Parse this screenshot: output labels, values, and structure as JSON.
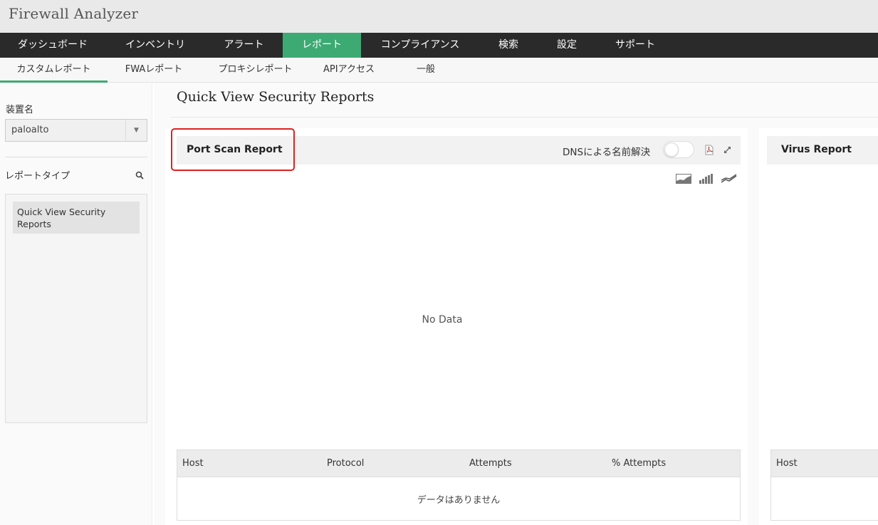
{
  "app": {
    "title": "Firewall Analyzer"
  },
  "colors": {
    "accent": "#3daa73",
    "nav_bg": "#2a2a2a",
    "highlight": "#e02020"
  },
  "mainnav": [
    {
      "label": "ダッシュボード"
    },
    {
      "label": "インベントリ"
    },
    {
      "label": "アラート"
    },
    {
      "label": "レポート",
      "active": true
    },
    {
      "label": "コンプライアンス"
    },
    {
      "label": "検索"
    },
    {
      "label": "設定"
    },
    {
      "label": "サポート"
    }
  ],
  "subnav": [
    {
      "label": "カスタムレポート",
      "active": true
    },
    {
      "label": "FWAレポート"
    },
    {
      "label": "プロキシレポート"
    },
    {
      "label": "APIアクセス"
    },
    {
      "label": "一般"
    }
  ],
  "sidebar": {
    "device_label": "装置名",
    "device_value": "paloalto",
    "report_type_label": "レポートタイプ",
    "search_icon": "search-icon",
    "reports": [
      "Quick View Security Reports"
    ]
  },
  "main": {
    "title": "Quick View Security Reports",
    "panels": [
      {
        "title": "Port Scan Report",
        "dns_label": "DNSによる名前解決",
        "dns_enabled": false,
        "icons": [
          "pdf-icon",
          "expand-icon",
          "area-chart-icon",
          "bar-chart-icon",
          "line-chart-icon"
        ],
        "no_data": "No Data",
        "columns": [
          "Host",
          "Protocol",
          "Attempts",
          "% Attempts"
        ],
        "empty_text": "データはありません"
      },
      {
        "title": "Virus Report",
        "columns": [
          "Host"
        ]
      }
    ]
  }
}
